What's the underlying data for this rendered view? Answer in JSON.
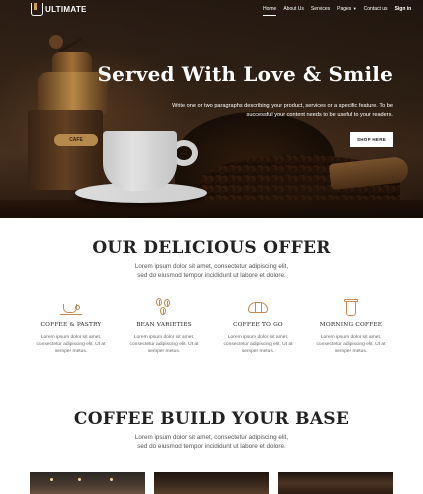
{
  "brand": {
    "name": "ULTIMATE"
  },
  "nav": {
    "items": [
      {
        "label": "Home",
        "active": true
      },
      {
        "label": "About Us"
      },
      {
        "label": "Services"
      },
      {
        "label": "Pages",
        "has_dropdown": true
      },
      {
        "label": "Contact us"
      },
      {
        "label": "Sign in"
      }
    ]
  },
  "hero": {
    "title": "Served With Love & Smile",
    "description": "Write one or two paragraphs describing your product, services or a specific feature. To be successful your content needs to be useful to your readers.",
    "button_label": "SHOP HERE",
    "grinder_label": "CAFE"
  },
  "offer": {
    "title": "OUR DELICIOUS OFFER",
    "subtitle_line1": "Lorem ipsum dolor sit amet, consectetur adipiscing elit,",
    "subtitle_line2": "sed do eiusmod tempor incididunt ut labore et dolore.",
    "features": [
      {
        "icon": "coffee-cup-icon",
        "name": "COFFEE & PASTRY",
        "desc_line1": "Lorem ipsum dolor sit amet,",
        "desc_line2": "consectetur adipiscing elit. Ut at",
        "desc_line3": "semper metus."
      },
      {
        "icon": "coffee-beans-icon",
        "name": "BEAN VARIETIES",
        "desc_line1": "Lorem ipsum dolor sit amet,",
        "desc_line2": "consectetur adipiscing elit. Ut at",
        "desc_line3": "semper metus."
      },
      {
        "icon": "croissant-icon",
        "name": "COFFEE TO GO",
        "desc_line1": "Lorem ipsum dolor sit amet,",
        "desc_line2": "consectetur adipiscing elit. Ut at",
        "desc_line3": "semper metus."
      },
      {
        "icon": "takeaway-cup-icon",
        "name": "MORNING COFFEE",
        "desc_line1": "Lorem ipsum dolor sit amet,",
        "desc_line2": "consectetur adipiscing elit. Ut at",
        "desc_line3": "semper metus."
      }
    ]
  },
  "base": {
    "title": "COFFEE BUILD YOUR BASE",
    "subtitle_line1": "Lorem ipsum dolor sit amet, consectetur adipiscing elit,",
    "subtitle_line2": "sed do eiusmod tempor incididunt ut labore et dolore."
  },
  "colors": {
    "accent_icon": "#c48b53",
    "hero_dark": "#2b1d14",
    "text_dark": "#222222"
  }
}
